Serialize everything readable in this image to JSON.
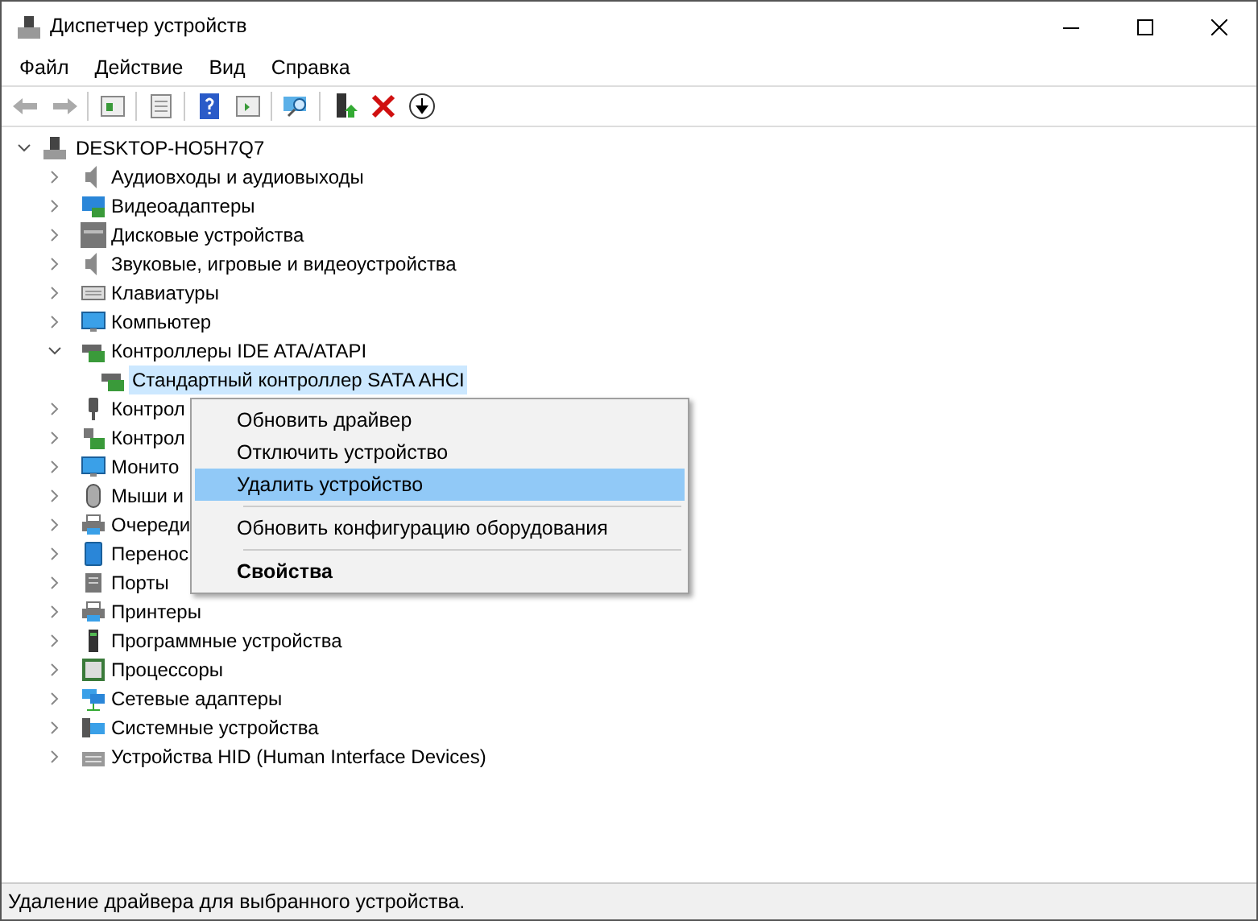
{
  "window": {
    "title": "Диспетчер устройств"
  },
  "menu_bar": [
    "Файл",
    "Действие",
    "Вид",
    "Справка"
  ],
  "tree": {
    "label": "DESKTOP-HO5H7Q7",
    "expanded": true,
    "children": [
      {
        "label": "Аудиовходы и аудиовыходы",
        "expanded": false
      },
      {
        "label": "Видеоадаптеры",
        "expanded": false
      },
      {
        "label": "Дисковые устройства",
        "expanded": false
      },
      {
        "label": "Звуковые, игровые и видеоустройства",
        "expanded": false
      },
      {
        "label": "Клавиатуры",
        "expanded": false
      },
      {
        "label": "Компьютер",
        "expanded": false
      },
      {
        "label": "Контроллеры IDE ATA/ATAPI",
        "expanded": true,
        "children": [
          {
            "label": "Стандартный контроллер SATA AHCI",
            "selected": true
          }
        ]
      },
      {
        "label": "Контрол",
        "expanded": false
      },
      {
        "label": "Контрол",
        "expanded": false
      },
      {
        "label": "Монито",
        "expanded": false
      },
      {
        "label": "Мыши и",
        "expanded": false
      },
      {
        "label": "Очереди",
        "expanded": false
      },
      {
        "label": "Перенос",
        "expanded": false
      },
      {
        "label": "Порты",
        "expanded": false
      },
      {
        "label": "Принтеры",
        "expanded": false
      },
      {
        "label": "Программные устройства",
        "expanded": false
      },
      {
        "label": "Процессоры",
        "expanded": false
      },
      {
        "label": "Сетевые адаптеры",
        "expanded": false
      },
      {
        "label": "Системные устройства",
        "expanded": false
      },
      {
        "label": "Устройства HID (Human Interface Devices)",
        "expanded": false
      }
    ]
  },
  "context_menu": [
    {
      "kind": "item",
      "label": "Обновить драйвер",
      "selected": false
    },
    {
      "kind": "item",
      "label": "Отключить устройство",
      "selected": false
    },
    {
      "kind": "item",
      "label": "Удалить устройство",
      "selected": true
    },
    {
      "kind": "separator"
    },
    {
      "kind": "item",
      "label": "Обновить конфигурацию оборудования",
      "selected": false
    },
    {
      "kind": "separator"
    },
    {
      "kind": "default",
      "label": "Свойства",
      "selected": false
    }
  ],
  "status_bar": "Удаление драйвера для выбранного устройства."
}
